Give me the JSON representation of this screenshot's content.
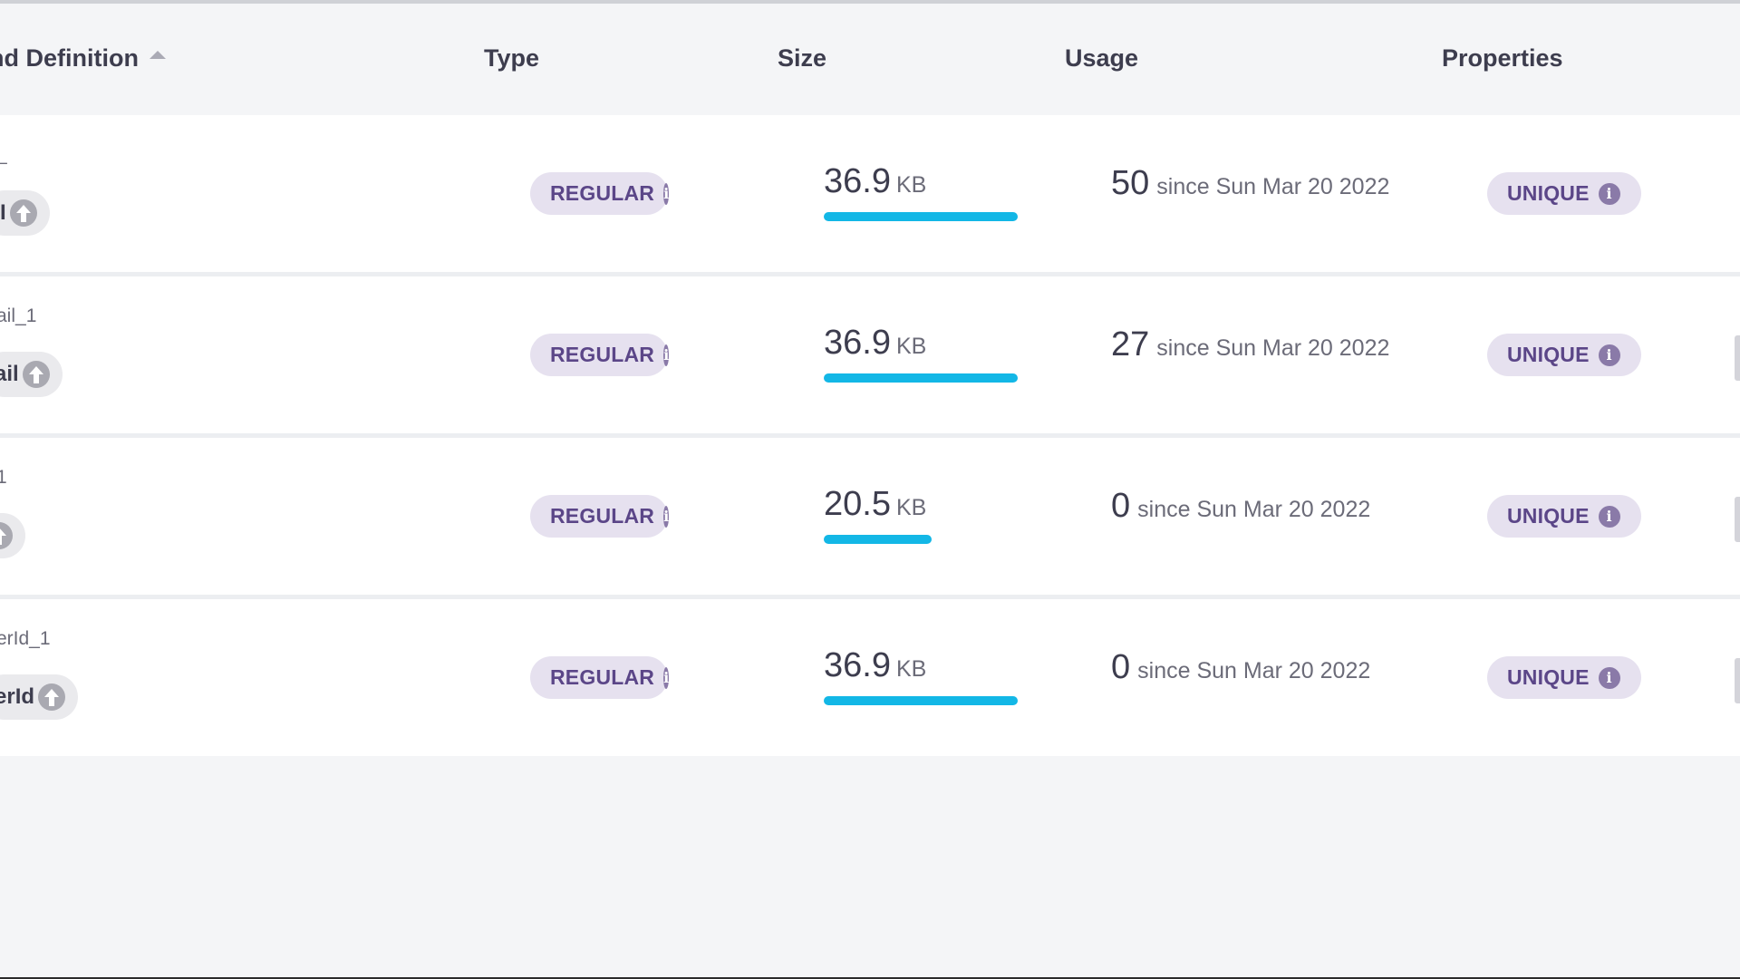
{
  "header": {
    "definition": "nd Definition",
    "type": "Type",
    "size": "Size",
    "usage": "Usage",
    "properties": "Properties"
  },
  "rows": [
    {
      "name": "_",
      "field": "I",
      "type": "REGULAR",
      "size_value": "36.9",
      "size_unit": "KB",
      "size_fraction": 1.0,
      "usage_count": "50",
      "usage_since": "since Sun Mar 20 2022",
      "property": "UNIQUE"
    },
    {
      "name": "ail_1",
      "field": "ail",
      "type": "REGULAR",
      "size_value": "36.9",
      "size_unit": "KB",
      "size_fraction": 1.0,
      "usage_count": "27",
      "usage_since": "since Sun Mar 20 2022",
      "property": "UNIQUE"
    },
    {
      "name": "1",
      "field": "",
      "type": "REGULAR",
      "size_value": "20.5",
      "size_unit": "KB",
      "size_fraction": 0.556,
      "usage_count": "0",
      "usage_since": "since Sun Mar 20 2022",
      "property": "UNIQUE"
    },
    {
      "name": "erId_1",
      "field": "erId",
      "type": "REGULAR",
      "size_value": "36.9",
      "size_unit": "KB",
      "size_fraction": 1.0,
      "usage_count": "0",
      "usage_since": "since Sun Mar 20 2022",
      "property": "UNIQUE"
    }
  ],
  "icons": {
    "sort": "sort-ascending-icon",
    "info": "info-icon",
    "upload": "arrow-up-circle-icon"
  },
  "colors": {
    "size_bar": "#13b7e6",
    "badge_bg": "#e6e1ef",
    "badge_text": "#5b4688"
  }
}
